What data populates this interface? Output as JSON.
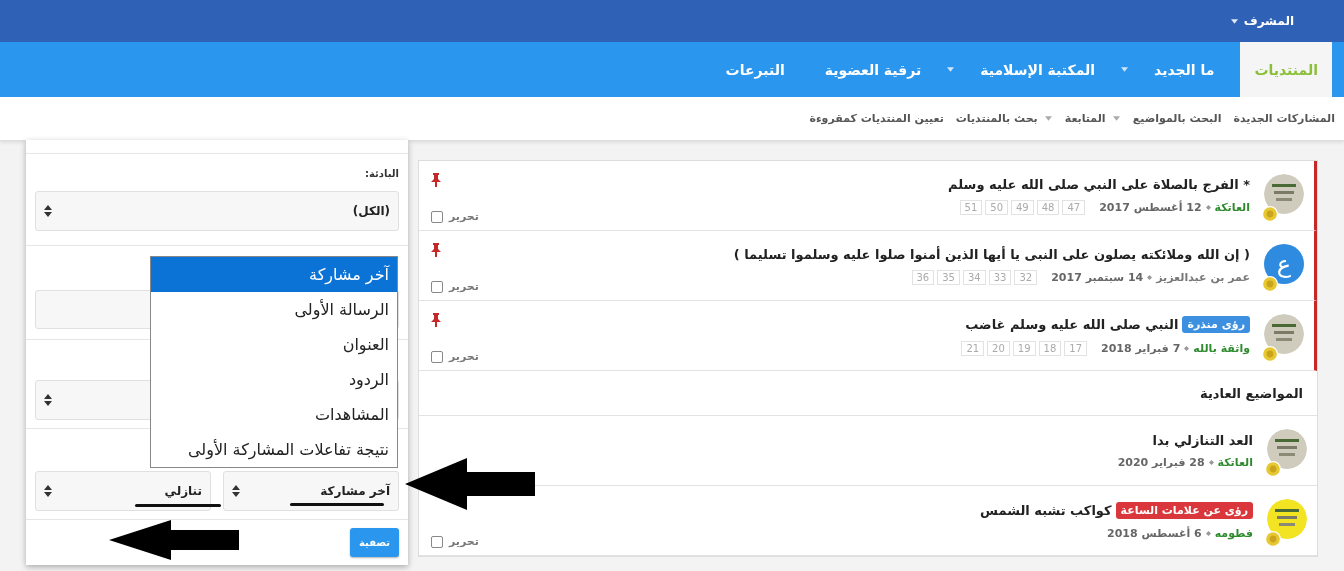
{
  "top_bar": {
    "user_menu": "المشرف"
  },
  "nav_tabs": [
    {
      "label": "المنتديات",
      "selected": true,
      "has_menu": false
    },
    {
      "label": "ما الجديد",
      "selected": false,
      "has_menu": true
    },
    {
      "label": "المكتبة الإسلامية",
      "selected": false,
      "has_menu": true
    },
    {
      "label": "ترقية العضوية",
      "selected": false,
      "has_menu": false
    },
    {
      "label": "التبرعات",
      "selected": false,
      "has_menu": false
    }
  ],
  "sub_nav": [
    {
      "label": "المشاركات الجديدة",
      "has_menu": false
    },
    {
      "label": "البحث بالمواضيع",
      "has_menu": true
    },
    {
      "label": "المتابعة",
      "has_menu": true
    },
    {
      "label": "بحث بالمنتديات",
      "has_menu": false
    },
    {
      "label": "تعيين المنتديات كمقروءة",
      "has_menu": false
    }
  ],
  "sticky_threads": [
    {
      "title": "* الفرج بالصلاة على النبي صلى الله عليه وسلم",
      "author": {
        "name": "العاتكة",
        "color": "#2e8b2e"
      },
      "date": "12 أغسطس 2017",
      "pages": [
        "47",
        "48",
        "49",
        "50",
        "51"
      ],
      "pinned": true,
      "edit_label": "تحرير",
      "checked": false
    },
    {
      "title": "( إن الله وملائكته يصلون على النبى يا أيها الذين أمنوا صلوا عليه وسلموا تسليما )",
      "avatar_letter": "ع",
      "author": {
        "name": "عمر بن عبدالعزيز",
        "color": "#777777"
      },
      "date": "14 سبتمبر 2017",
      "pages": [
        "32",
        "33",
        "34",
        "35",
        "36"
      ],
      "pinned": true,
      "edit_label": "تحرير",
      "checked": false
    },
    {
      "title": "النبي صلى الله عليه وسلم غاضب",
      "prefix": {
        "label": "رؤى منذرة",
        "color": "#3d8fe0"
      },
      "author": {
        "name": "واثقة بالله",
        "color": "#2e8b2e"
      },
      "date": "7 فبراير 2018",
      "pages": [
        "17",
        "18",
        "19",
        "20",
        "21"
      ],
      "pinned": true,
      "edit_label": "تحرير",
      "checked": false
    }
  ],
  "normal_section": {
    "title": "المواضيع العادية",
    "threads": [
      {
        "title": "العد التنازلي بدا",
        "author": {
          "name": "العاتكة",
          "color": "#2e8b2e"
        },
        "date": "28 فبراير 2020"
      },
      {
        "title": "كواكب تشبه الشمس",
        "prefix": {
          "label": "رؤى عن علامات الساعة",
          "color": "#d9373b"
        },
        "author": {
          "name": "فطومه",
          "color": "#2e8b2e"
        },
        "date": "6 أغسطس 2018",
        "edit_label": "تحرير",
        "checked": false
      }
    ]
  },
  "filter_popup": {
    "prefix_label": "البادئة:",
    "prefix_value": "(الكل)",
    "sort_value": "آخر مشاركة",
    "order_value": "تنازلي",
    "submit": "تصفية",
    "sort_options": [
      {
        "label": "آخر مشاركة",
        "selected": true
      },
      {
        "label": "الرسالة الأولى",
        "selected": false
      },
      {
        "label": "العنوان",
        "selected": false
      },
      {
        "label": "الردود",
        "selected": false
      },
      {
        "label": "المشاهدات",
        "selected": false
      },
      {
        "label": "نتيجة تفاعلات المشاركة الأولى",
        "selected": false
      }
    ]
  }
}
